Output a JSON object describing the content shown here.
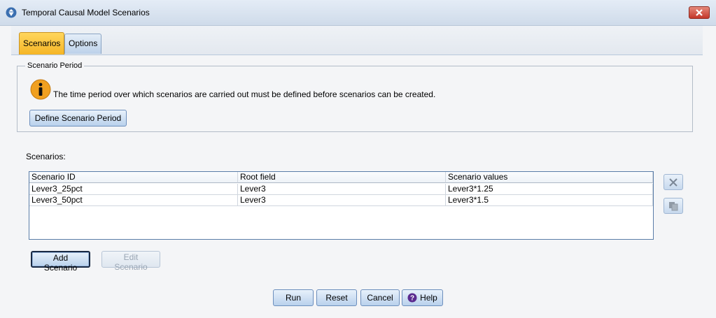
{
  "window": {
    "title": "Temporal Causal Model Scenarios"
  },
  "tabs": [
    {
      "label": "Scenarios",
      "active": true
    },
    {
      "label": "Options",
      "active": false
    }
  ],
  "scenario_period": {
    "group_title": "Scenario Period",
    "info_text": "The time period over which scenarios are carried out must be defined before scenarios can be created.",
    "define_button": "Define Scenario Period"
  },
  "scenarios": {
    "label": "Scenarios:",
    "columns": [
      "Scenario ID",
      "Root field",
      "Scenario values"
    ],
    "rows": [
      [
        "Lever3_25pct",
        "Lever3",
        "Lever3*1.25"
      ],
      [
        "Lever3_50pct",
        "Lever3",
        "Lever3*1.5"
      ]
    ],
    "add_button": "Add Scenario",
    "edit_button": "Edit Scenario"
  },
  "footer": {
    "run": "Run",
    "reset": "Reset",
    "cancel": "Cancel",
    "help": "Help"
  },
  "colors": {
    "active_tab": "#f5b526",
    "accent_border": "#5a7da8",
    "close_red": "#c4372a"
  },
  "icons": {
    "app": "diamond-app-icon",
    "info": "info-icon",
    "delete": "delete-x-icon",
    "copy": "copy-icon",
    "help": "help-question-icon"
  }
}
